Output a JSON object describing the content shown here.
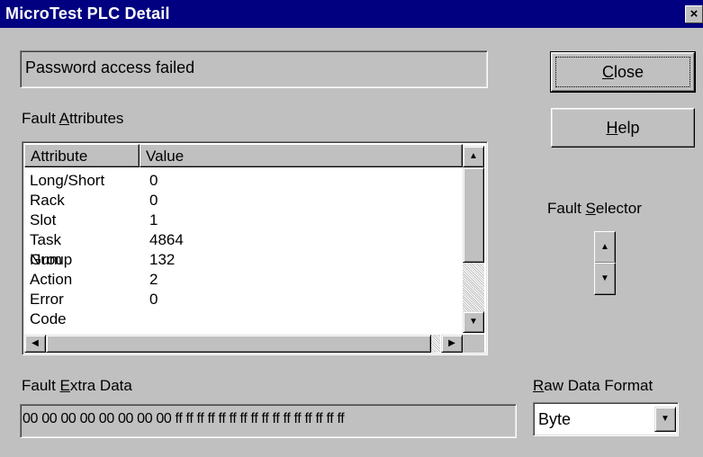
{
  "window": {
    "title": "MicroTest PLC Detail",
    "close_glyph": "×"
  },
  "status": {
    "message": "Password access failed"
  },
  "buttons": {
    "close": "Close",
    "close_mnemonic": "C",
    "close_rest": "lose",
    "help_mnemonic": "H",
    "help_rest": "elp"
  },
  "fault_attributes": {
    "label_pre": "Fault ",
    "label_mn": "A",
    "label_post": "ttributes",
    "columns": [
      "Attribute",
      "Value"
    ],
    "rows": [
      {
        "attribute": "Long/Short",
        "value": "0"
      },
      {
        "attribute": "Rack",
        "value": "0"
      },
      {
        "attribute": "Slot",
        "value": "1"
      },
      {
        "attribute": "Task Num",
        "value": "4864"
      },
      {
        "attribute": "Group",
        "value": "132"
      },
      {
        "attribute": "Action",
        "value": "2"
      },
      {
        "attribute": "Error Code",
        "value": "0"
      }
    ]
  },
  "fault_selector": {
    "label_pre": "Fault ",
    "label_mn": "S",
    "label_post": "elector"
  },
  "extra_data": {
    "label_pre": "Fault ",
    "label_mn": "E",
    "label_post": "xtra Data",
    "value": "00 00 00 00 00 00 00 00 ff ff ff ff ff ff ff ff ff ff ff ff ff ff ff ff"
  },
  "raw_format": {
    "label_mn": "R",
    "label_post": "aw Data Format",
    "selected": "Byte"
  },
  "icons": [
    "close-x-icon",
    "scroll-up-icon",
    "scroll-down-icon",
    "scroll-left-icon",
    "scroll-right-icon",
    "spin-up-icon",
    "spin-down-icon",
    "dropdown-arrow-icon"
  ]
}
